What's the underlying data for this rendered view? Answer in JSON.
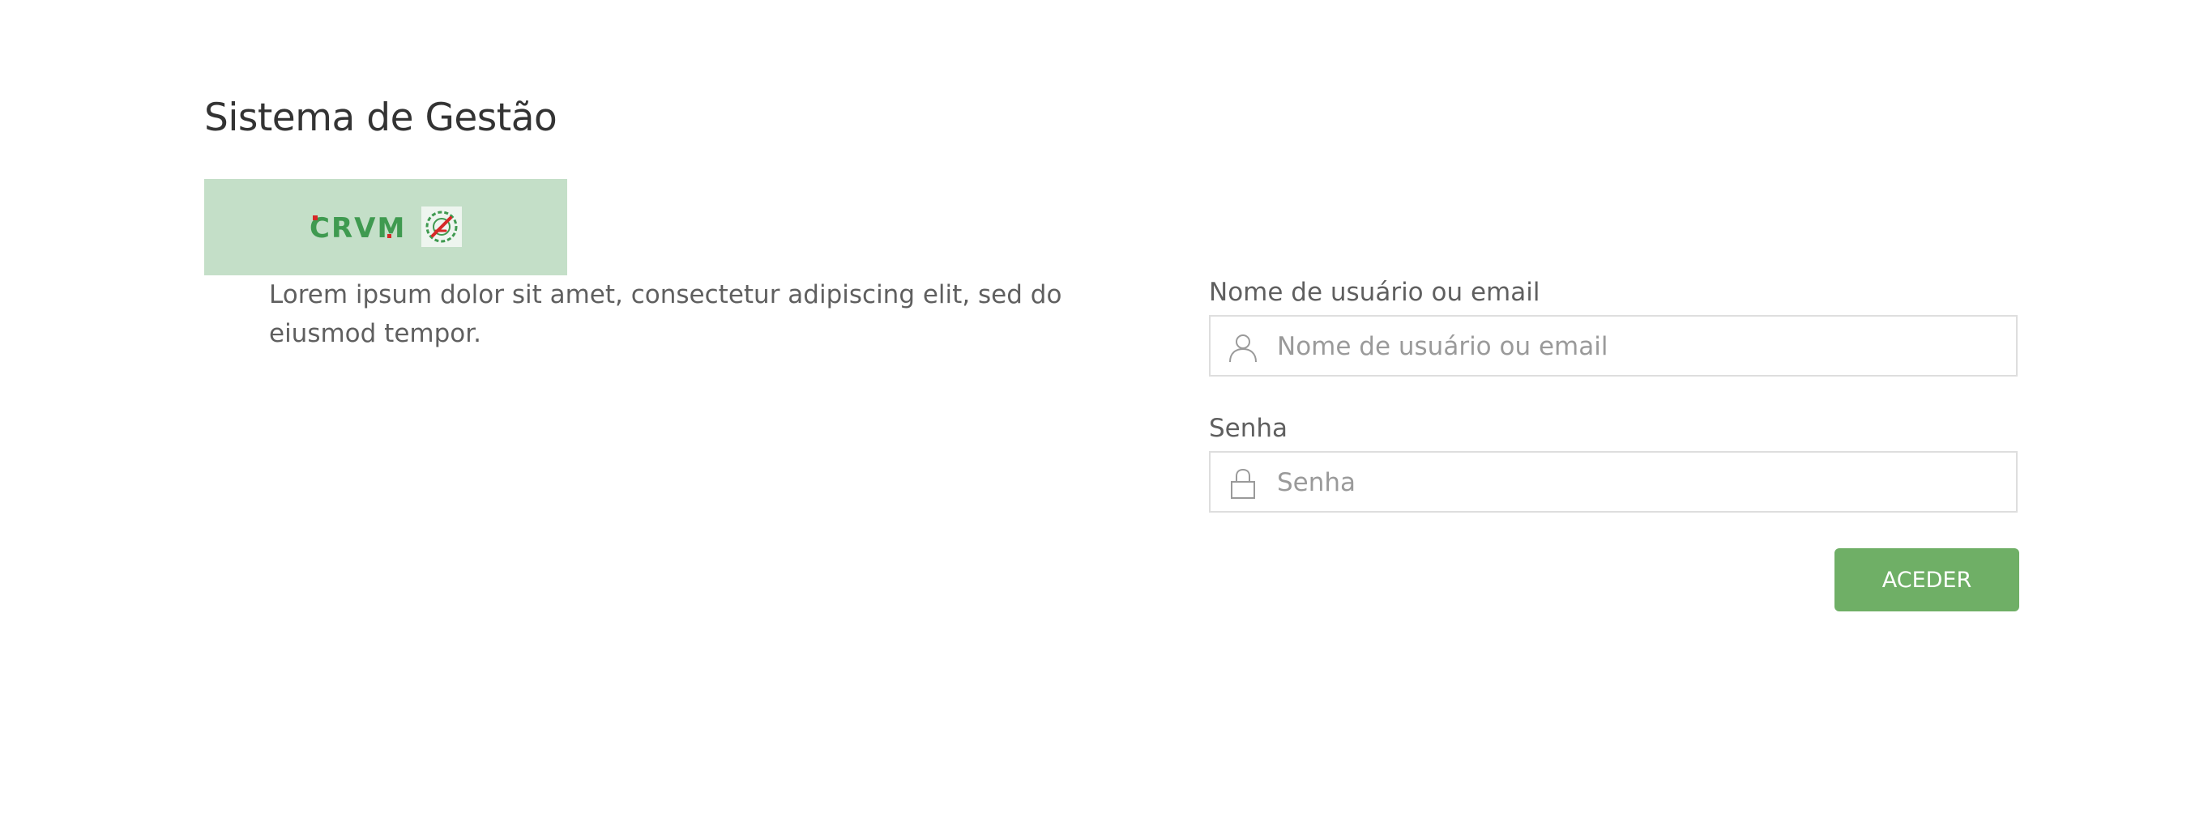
{
  "header": {
    "title": "Sistema de Gestão"
  },
  "logo": {
    "wordmark": "CRVM",
    "background": "#c4dfc8",
    "wordmark_color": "#3f9a50",
    "accent_color": "#d62828"
  },
  "intro": {
    "text": "Lorem ipsum dolor sit amet, consectetur adipiscing elit, sed do eiusmod tempor."
  },
  "login_form": {
    "username": {
      "label": "Nome de usuário ou email",
      "placeholder": "Nome de usuário ou email",
      "value": "",
      "icon": "user-icon"
    },
    "password": {
      "label": "Senha",
      "placeholder": "Senha",
      "value": "",
      "icon": "lock-icon"
    },
    "submit": {
      "label": "ACEDER",
      "color": "#6faf66"
    }
  }
}
